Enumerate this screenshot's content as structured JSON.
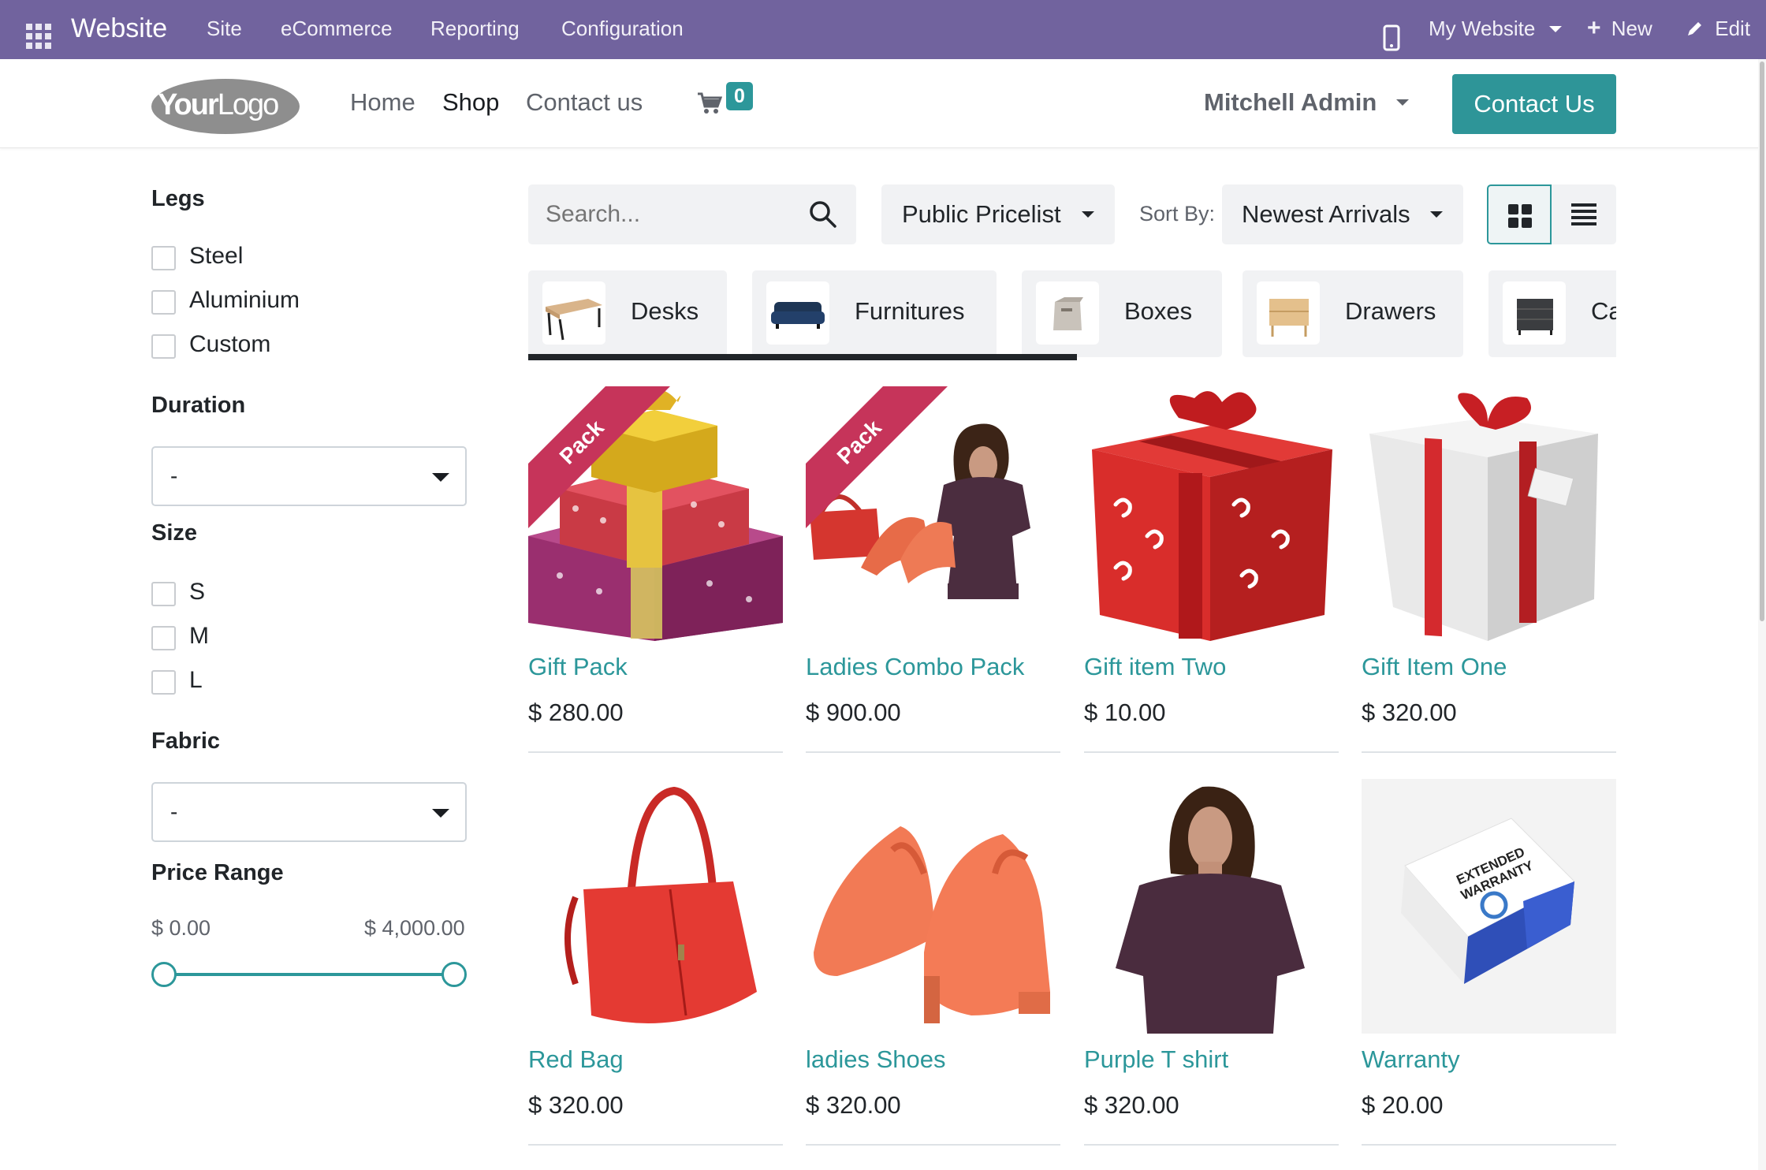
{
  "adminbar": {
    "brand": "Website",
    "menu": [
      "Site",
      "eCommerce",
      "Reporting",
      "Configuration"
    ],
    "my_website": "My Website",
    "new_label": "New",
    "edit_label": "Edit"
  },
  "header": {
    "logo_text": "YourLogo",
    "nav": [
      "Home",
      "Shop",
      "Contact us"
    ],
    "active_nav": "Shop",
    "cart_count": "0",
    "user": "Mitchell Admin",
    "cta": "Contact Us"
  },
  "sidebar": {
    "legs": {
      "title": "Legs",
      "options": [
        "Steel",
        "Aluminium",
        "Custom"
      ]
    },
    "duration": {
      "title": "Duration",
      "value": "-"
    },
    "size": {
      "title": "Size",
      "options": [
        "S",
        "M",
        "L"
      ]
    },
    "fabric": {
      "title": "Fabric",
      "value": "-"
    },
    "price_range": {
      "title": "Price Range",
      "min": "$ 0.00",
      "max": "$ 4,000.00",
      "selected_min_fraction": 0,
      "selected_max_fraction": 1
    }
  },
  "toolbar": {
    "search_placeholder": "Search...",
    "pricelist": "Public Pricelist",
    "sort_label": "Sort By:",
    "sort_value": "Newest Arrivals",
    "view_mode": "grid"
  },
  "categories": [
    "Desks",
    "Furnitures",
    "Boxes",
    "Drawers",
    "Ca"
  ],
  "products": [
    {
      "name": "Gift Pack",
      "price": "$ 280.00",
      "ribbon": "Pack"
    },
    {
      "name": "Ladies Combo Pack",
      "price": "$ 900.00",
      "ribbon": "Pack"
    },
    {
      "name": "Gift item Two",
      "price": "$ 10.00"
    },
    {
      "name": "Gift Item One",
      "price": "$ 320.00"
    },
    {
      "name": "Red Bag",
      "price": "$ 320.00"
    },
    {
      "name": "ladies Shoes",
      "price": "$ 320.00"
    },
    {
      "name": "Purple T shirt",
      "price": "$ 320.00"
    },
    {
      "name": "Warranty",
      "price": "$ 20.00",
      "box_text": "EXTENDED WARRANTY"
    }
  ],
  "colors": {
    "admin_bar": "#71639e",
    "primary": "#2c979a",
    "cta": "#2e9598",
    "ribbon": "#c6345a"
  }
}
